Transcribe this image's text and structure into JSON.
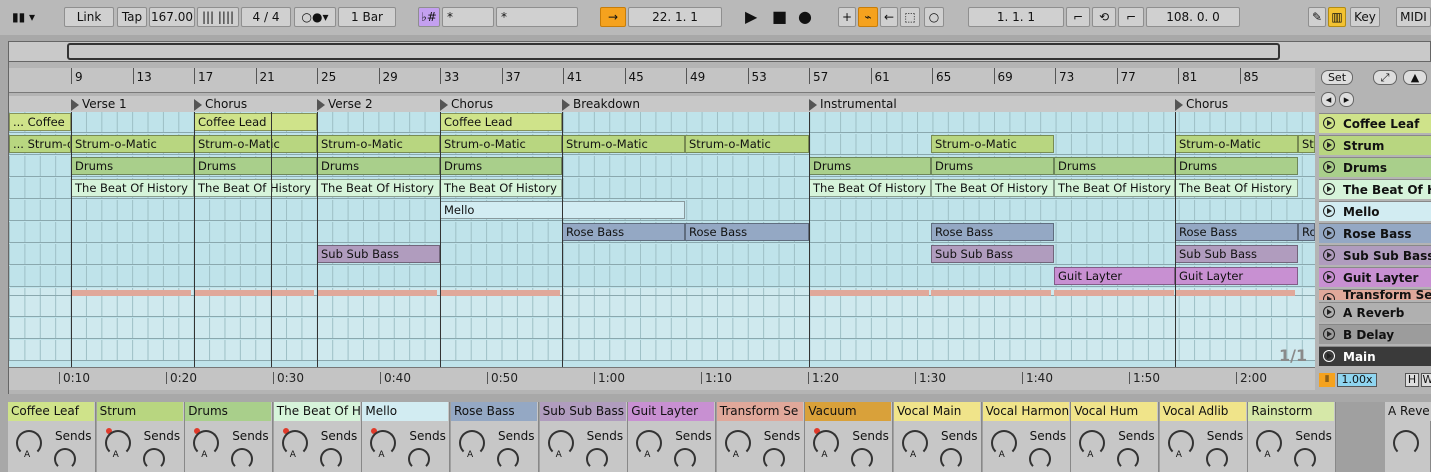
{
  "control_bar": {
    "link": "Link",
    "tap": "Tap",
    "tempo": "167.00",
    "time_signature": "4 / 4",
    "metro_icon": "metronome-icon",
    "quantize": "1 Bar",
    "key_btn": "♭#",
    "scale_1": "*",
    "scale_2": "*",
    "position": "22.   1.   1",
    "loop_start": "1.   1.   1",
    "loop_length": "108.   0.   0",
    "key": "Key",
    "midi": "MIDI"
  },
  "ruler": {
    "bars": [
      "9",
      "13",
      "17",
      "21",
      "25",
      "29",
      "33",
      "37",
      "41",
      "45",
      "49",
      "53",
      "57",
      "61",
      "65",
      "69",
      "73",
      "77",
      "81",
      "85"
    ],
    "set_btn": "Set"
  },
  "locators": [
    {
      "name": "Verse 1"
    },
    {
      "name": "Chorus"
    },
    {
      "name": "Verse 2"
    },
    {
      "name": "Chorus"
    },
    {
      "name": "Breakdown"
    },
    {
      "name": "Instrumental"
    },
    {
      "name": "Chorus"
    }
  ],
  "tracks": [
    {
      "name": "Coffee Leaf",
      "color": "#cfe38a",
      "clips": [
        {
          "label": "... Coffee"
        },
        {
          "label": "Coffee Lead"
        },
        {
          "label": "Coffee Lead"
        }
      ]
    },
    {
      "name": "Strum",
      "color": "#b8d680",
      "clips": [
        {
          "label": "... Strum-o"
        },
        {
          "label": "Strum-o-Matic"
        },
        {
          "label": "Strum-o-Matic"
        },
        {
          "label": "Strum-o-Matic"
        },
        {
          "label": "Strum-o-Matic"
        },
        {
          "label": "Strum-o-Matic"
        },
        {
          "label": "Strum-o-Matic"
        },
        {
          "label": "Strum-o-Matic"
        },
        {
          "label": "Strum-o-Matic"
        },
        {
          "label": "Sti"
        }
      ]
    },
    {
      "name": "Drums",
      "color": "#a9cf8b",
      "clips": [
        {
          "label": "Drums"
        },
        {
          "label": "Drums"
        },
        {
          "label": "Drums"
        },
        {
          "label": "Drums"
        },
        {
          "label": "Drums"
        },
        {
          "label": "Drums"
        },
        {
          "label": "Drums"
        },
        {
          "label": "Drums"
        }
      ]
    },
    {
      "name": "The Beat Of His",
      "color": "#d6f4da",
      "clips": [
        {
          "label": "The Beat Of History"
        },
        {
          "label": "The Beat Of History"
        },
        {
          "label": "The Beat Of History"
        },
        {
          "label": "The Beat Of History"
        },
        {
          "label": "The Beat Of History"
        },
        {
          "label": "The Beat Of History"
        },
        {
          "label": "The Beat Of History"
        },
        {
          "label": "The Beat Of History"
        }
      ]
    },
    {
      "name": "Mello",
      "color": "#d2ecf2",
      "clips": [
        {
          "label": "Mello"
        }
      ]
    },
    {
      "name": "Rose Bass",
      "color": "#94a8c4",
      "clips": [
        {
          "label": "Rose Bass"
        },
        {
          "label": "Rose Bass"
        },
        {
          "label": "Rose Bass"
        },
        {
          "label": "Rose Bass"
        },
        {
          "label": "Ro"
        }
      ]
    },
    {
      "name": "Sub Sub Bass",
      "color": "#b09cbe",
      "clips": [
        {
          "label": "Sub Sub Bass"
        },
        {
          "label": "Sub Sub Bass"
        },
        {
          "label": "Sub Sub Bass"
        }
      ]
    },
    {
      "name": "Guit Layter",
      "color": "#c890d2",
      "clips": [
        {
          "label": "Guit Layter"
        },
        {
          "label": "Guit Layter"
        }
      ]
    },
    {
      "name": "Transform Se",
      "color": "#e0a89a",
      "clips": []
    },
    {
      "name": "A Reverb",
      "color": "#b0b0b0",
      "clips": []
    },
    {
      "name": "B Delay",
      "color": "#9c9c9c",
      "clips": []
    },
    {
      "name": "Main",
      "color": "#3a3a3a",
      "clips": []
    }
  ],
  "page_indicator": "1/1",
  "time_ruler": [
    "0:10",
    "0:20",
    "0:30",
    "0:40",
    "0:50",
    "1:00",
    "1:10",
    "1:20",
    "1:30",
    "1:40",
    "1:50",
    "2:00"
  ],
  "zoom": "1.00x",
  "h_btn": "H",
  "w_btn": "W",
  "mixer": {
    "sends_label": "Sends",
    "knob_label": "A",
    "channels": [
      {
        "name": "Coffee Leaf",
        "color": "#cfe38a",
        "armed": false
      },
      {
        "name": "Strum",
        "color": "#b8d680",
        "armed": true
      },
      {
        "name": "Drums",
        "color": "#a9cf8b",
        "armed": true
      },
      {
        "name": "The Beat Of H",
        "color": "#d6f4da",
        "armed": true
      },
      {
        "name": "Mello",
        "color": "#d2ecf2",
        "armed": true
      },
      {
        "name": "Rose Bass",
        "color": "#94a8c4",
        "armed": false
      },
      {
        "name": "Sub Sub Bass",
        "color": "#b09cbe",
        "armed": false
      },
      {
        "name": "Guit Layter",
        "color": "#c890d2",
        "armed": false
      },
      {
        "name": "Transform Se",
        "color": "#e0a89a",
        "armed": false
      },
      {
        "name": "Vacuum",
        "color": "#d9a13a",
        "armed": true
      },
      {
        "name": "Vocal Main",
        "color": "#f0e48a",
        "armed": false
      },
      {
        "name": "Vocal Harmon",
        "color": "#f0e48a",
        "armed": false
      },
      {
        "name": "Vocal Hum",
        "color": "#f0e48a",
        "armed": false
      },
      {
        "name": "Vocal Adlib",
        "color": "#f0e48a",
        "armed": false
      },
      {
        "name": "Rainstorm",
        "color": "#d6e8a8",
        "armed": false
      }
    ],
    "return_name": "A Reve"
  }
}
